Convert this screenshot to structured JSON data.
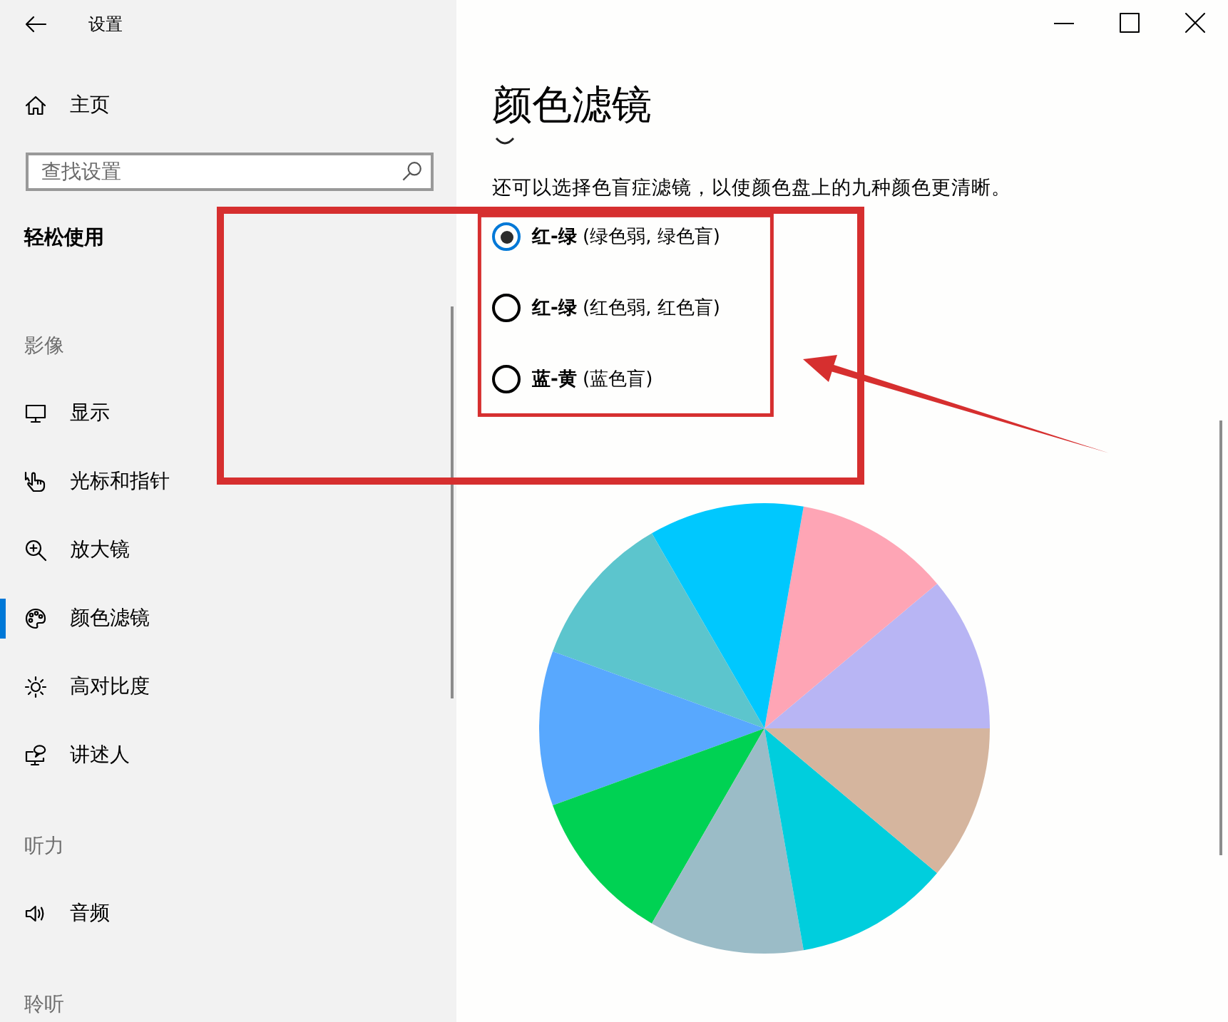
{
  "window": {
    "title": "设置"
  },
  "sidebar": {
    "home": {
      "label": "主页"
    },
    "search": {
      "placeholder": "查找设置"
    },
    "heading": "轻松使用",
    "groups": [
      {
        "title": "影像",
        "items": [
          {
            "kind": "display",
            "label": "显示",
            "selected": false
          },
          {
            "kind": "pointer",
            "label": "光标和指针",
            "selected": false
          },
          {
            "kind": "magnifier",
            "label": "放大镜",
            "selected": false
          },
          {
            "kind": "palette",
            "label": "颜色滤镜",
            "selected": true
          },
          {
            "kind": "contrast",
            "label": "高对比度",
            "selected": false
          },
          {
            "kind": "narrator",
            "label": "讲述人",
            "selected": false
          }
        ]
      },
      {
        "title": "听力",
        "items": [
          {
            "kind": "audio",
            "label": "音频",
            "selected": false
          }
        ]
      },
      {
        "title": "聆听"
      }
    ]
  },
  "content": {
    "title": "颜色滤镜",
    "description": "还可以选择色盲症滤镜，以使颜色盘上的九种颜色更清晰。",
    "options": [
      {
        "label": "**红-绿** (绿色弱, 绿色盲)",
        "selected": true
      },
      {
        "label": "**红-绿** (红色弱, 红色盲)",
        "selected": false
      },
      {
        "label": "**蓝-黄** (蓝色盲)",
        "selected": false
      }
    ]
  }
}
